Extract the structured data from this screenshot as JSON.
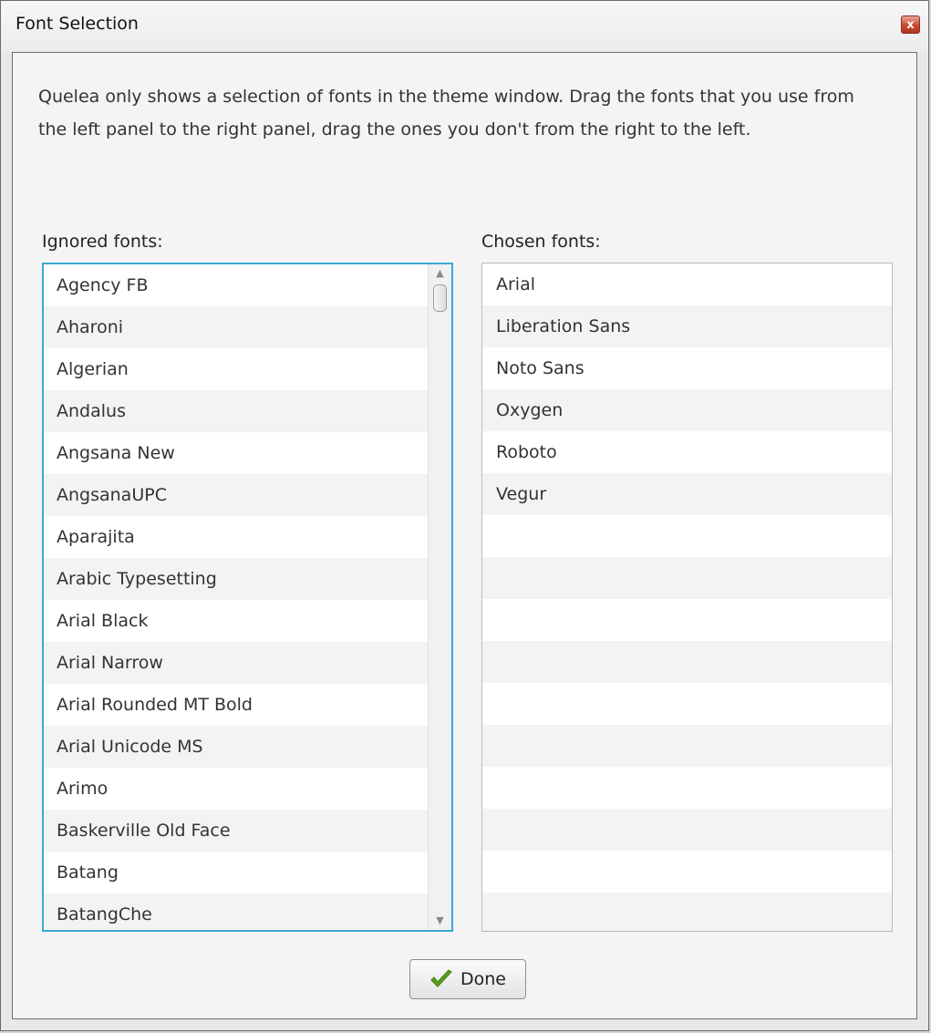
{
  "window": {
    "title": "Font Selection",
    "close_glyph": "x"
  },
  "description": "Quelea only shows a selection of fonts in the theme window. Drag the fonts that you use from the left panel to the right panel, drag the ones you don't from the right to the left.",
  "ignored": {
    "label": "Ignored fonts:",
    "items": [
      "Agency FB",
      "Aharoni",
      "Algerian",
      "Andalus",
      "Angsana New",
      "AngsanaUPC",
      "Aparajita",
      "Arabic Typesetting",
      "Arial Black",
      "Arial Narrow",
      "Arial Rounded MT Bold",
      "Arial Unicode MS",
      "Arimo",
      "Baskerville Old Face",
      "Batang",
      "BatangChe"
    ]
  },
  "chosen": {
    "label": "Chosen fonts:",
    "items": [
      "Arial",
      "Liberation Sans",
      "Noto Sans",
      "Oxygen",
      "Roboto",
      "Vegur"
    ]
  },
  "done_button": {
    "label": "Done",
    "icon": "checkmark-icon"
  },
  "colors": {
    "focus_border": "#3aa9d6",
    "check_green": "#5aa01e",
    "close_red": "#c8492f"
  }
}
